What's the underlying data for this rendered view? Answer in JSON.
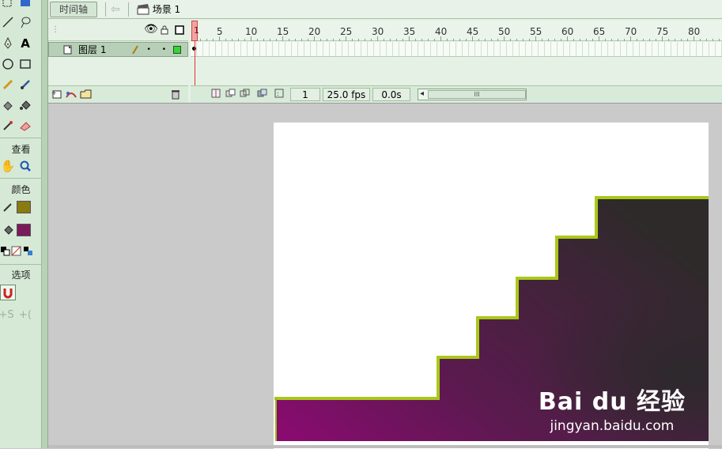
{
  "topbar": {
    "timeline_button": "时间轴",
    "scene_label": "场景 1"
  },
  "tools": {
    "section_view": "查看",
    "section_color": "颜色",
    "section_options": "选项",
    "stroke_color": "#8a7a10",
    "fill_color": "#7a1a5a"
  },
  "timeline": {
    "layer_name": "图层 1",
    "frame_ticks": [
      "1",
      "5",
      "10",
      "15",
      "20",
      "25",
      "30",
      "35",
      "40",
      "45",
      "50",
      "55",
      "60",
      "65",
      "70",
      "75",
      "80"
    ],
    "current_frame": "1",
    "frame_rate": "25.0 fps",
    "elapsed_time": "0.0s",
    "scrollbar_grip": "III"
  },
  "stage": {
    "shape_gradient_start": "#8c0a72",
    "shape_gradient_end": "#2e2a2a",
    "shape_outline": "#a9c81a",
    "watermark_logo": "Bai du 经验",
    "watermark_url": "jingyan.baidu.com"
  }
}
